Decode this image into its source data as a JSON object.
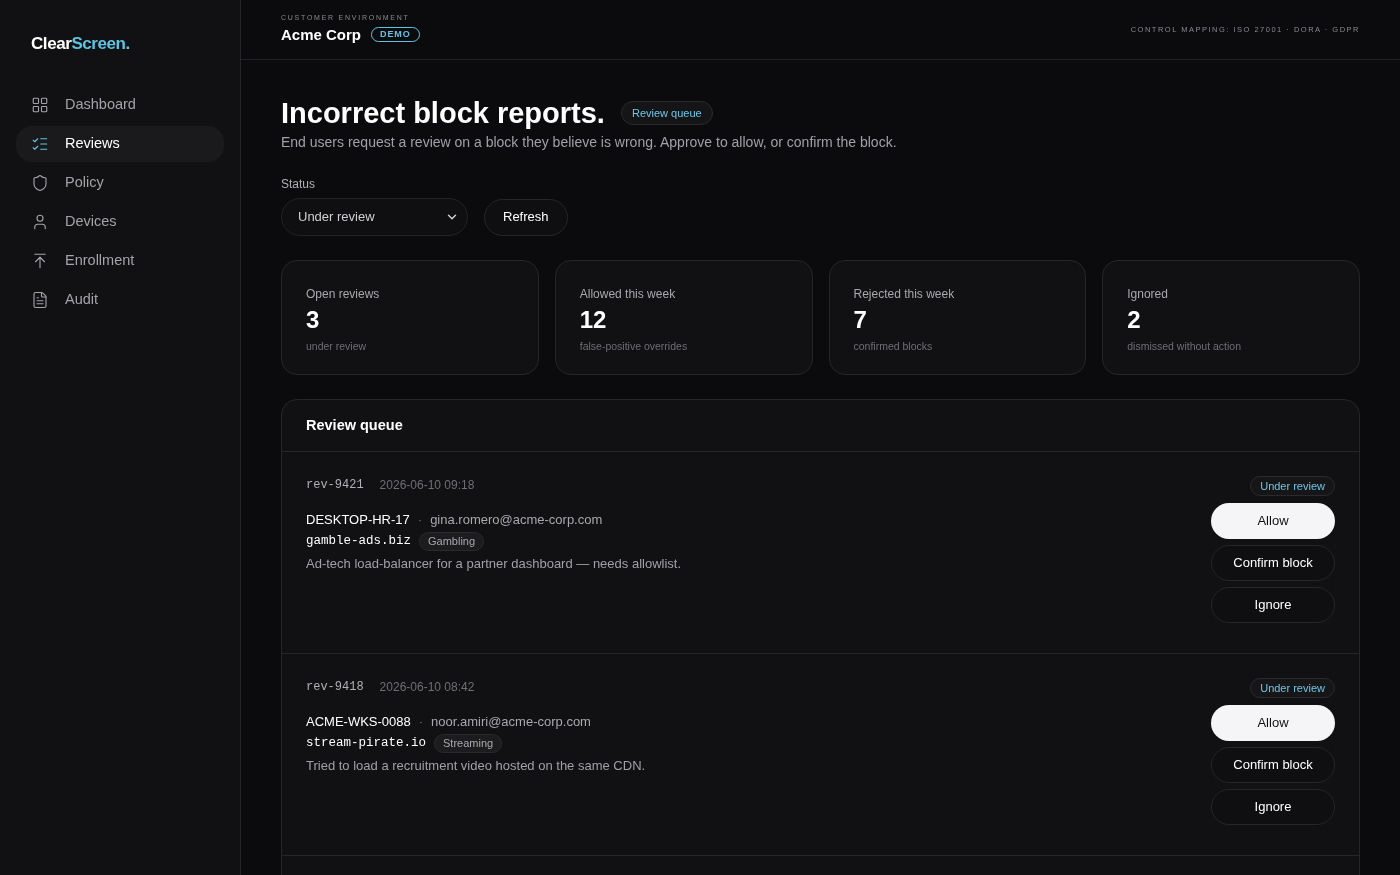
{
  "brand": {
    "first": "Clear",
    "second": "Screen."
  },
  "nav": [
    {
      "label": "Dashboard",
      "selected": false
    },
    {
      "label": "Reviews",
      "selected": true
    },
    {
      "label": "Policy",
      "selected": false
    },
    {
      "label": "Devices",
      "selected": false
    },
    {
      "label": "Enrollment",
      "selected": false
    },
    {
      "label": "Audit",
      "selected": false
    }
  ],
  "header": {
    "eyebrow": "CUSTOMER ENVIRONMENT",
    "customer": "Acme Corp",
    "badge": "DEMO",
    "mapping": "CONTROL MAPPING: ISO 27001 · DORA · GDPR"
  },
  "page": {
    "title": "Incorrect block reports.",
    "badge": "Review queue",
    "subtitle": "End users request a review on a block they believe is wrong. Approve to allow, or confirm the block."
  },
  "filter": {
    "label": "Status",
    "value": "Under review",
    "refresh": "Refresh"
  },
  "stats": [
    {
      "label": "Open reviews",
      "value": "3",
      "note": "under review"
    },
    {
      "label": "Allowed this week",
      "value": "12",
      "note": "false-positive overrides"
    },
    {
      "label": "Rejected this week",
      "value": "7",
      "note": "confirmed blocks"
    },
    {
      "label": "Ignored",
      "value": "2",
      "note": "dismissed without action"
    }
  ],
  "queue": {
    "title": "Review queue",
    "items": [
      {
        "id": "rev-9421",
        "time": "2026-06-10 09:18",
        "device": "DESKTOP-HR-17",
        "separator": "·",
        "email": "gina.romero@acme-corp.com",
        "domain": "gamble-ads.biz",
        "category": "Gambling",
        "note": "Ad-tech load-balancer for a partner dashboard — needs allowlist.",
        "status": "Under review",
        "actions": [
          {
            "label": "Allow",
            "kind": "primary"
          },
          {
            "label": "Confirm block",
            "kind": "secondary"
          },
          {
            "label": "Ignore",
            "kind": "secondary"
          }
        ]
      },
      {
        "id": "rev-9418",
        "time": "2026-06-10 08:42",
        "device": "ACME-WKS-0088",
        "separator": "·",
        "email": "noor.amiri@acme-corp.com",
        "domain": "stream-pirate.io",
        "category": "Streaming",
        "note": "Tried to load a recruitment video hosted on the same CDN.",
        "status": "Under review",
        "actions": [
          {
            "label": "Allow",
            "kind": "primary"
          },
          {
            "label": "Confirm block",
            "kind": "secondary"
          },
          {
            "label": "Ignore",
            "kind": "secondary"
          }
        ]
      }
    ]
  }
}
